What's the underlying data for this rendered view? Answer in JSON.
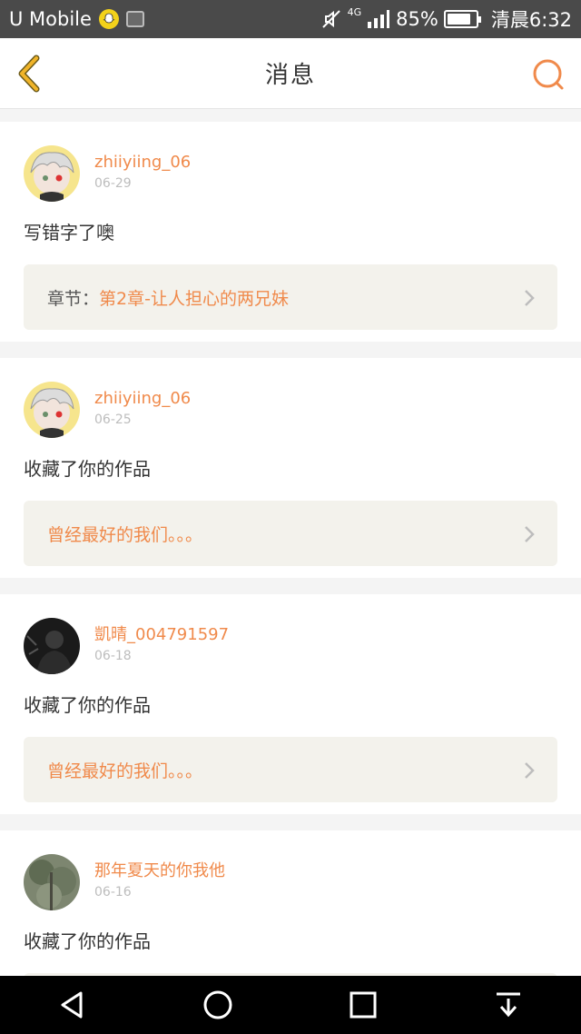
{
  "status_bar": {
    "carrier": "U Mobile",
    "network": "4G",
    "battery": "85%",
    "battery_level": 0.85,
    "time": "清晨6:32",
    "icons": [
      "snapchat-icon",
      "gallery-icon",
      "mute-icon",
      "signal-icon",
      "battery-icon"
    ]
  },
  "header": {
    "title": "消息",
    "back_icon": "back-chevron-icon",
    "search_icon": "search-icon"
  },
  "colors": {
    "accent": "#f08a4b",
    "back_icon": "#f0b429",
    "card_ref_bg": "#f3f2ec",
    "page_bg": "#f4f4f4"
  },
  "messages": [
    {
      "username": "zhiiyiing_06",
      "date": "06-29",
      "action": "写错字了噢",
      "ref_label": "章节：",
      "ref_text": "第2章-让人担心的两兄妹",
      "avatar": "anime-avatar"
    },
    {
      "username": "zhiiyiing_06",
      "date": "06-25",
      "action": "收藏了你的作品",
      "ref_label": "",
      "ref_text": "曾经最好的我们。。。",
      "avatar": "anime-avatar"
    },
    {
      "username": "凱晴_004791597",
      "date": "06-18",
      "action": "收藏了你的作品",
      "ref_label": "",
      "ref_text": "曾经最好的我们。。。",
      "avatar": "photo-avatar-dark"
    },
    {
      "username": "那年夏天的你我他",
      "date": "06-16",
      "action": "收藏了你的作品",
      "ref_label": "",
      "ref_text": "",
      "avatar": "photo-avatar-green"
    }
  ],
  "nav_bar": [
    "back-triangle-icon",
    "home-circle-icon",
    "recents-square-icon",
    "notification-pulldown-icon"
  ]
}
